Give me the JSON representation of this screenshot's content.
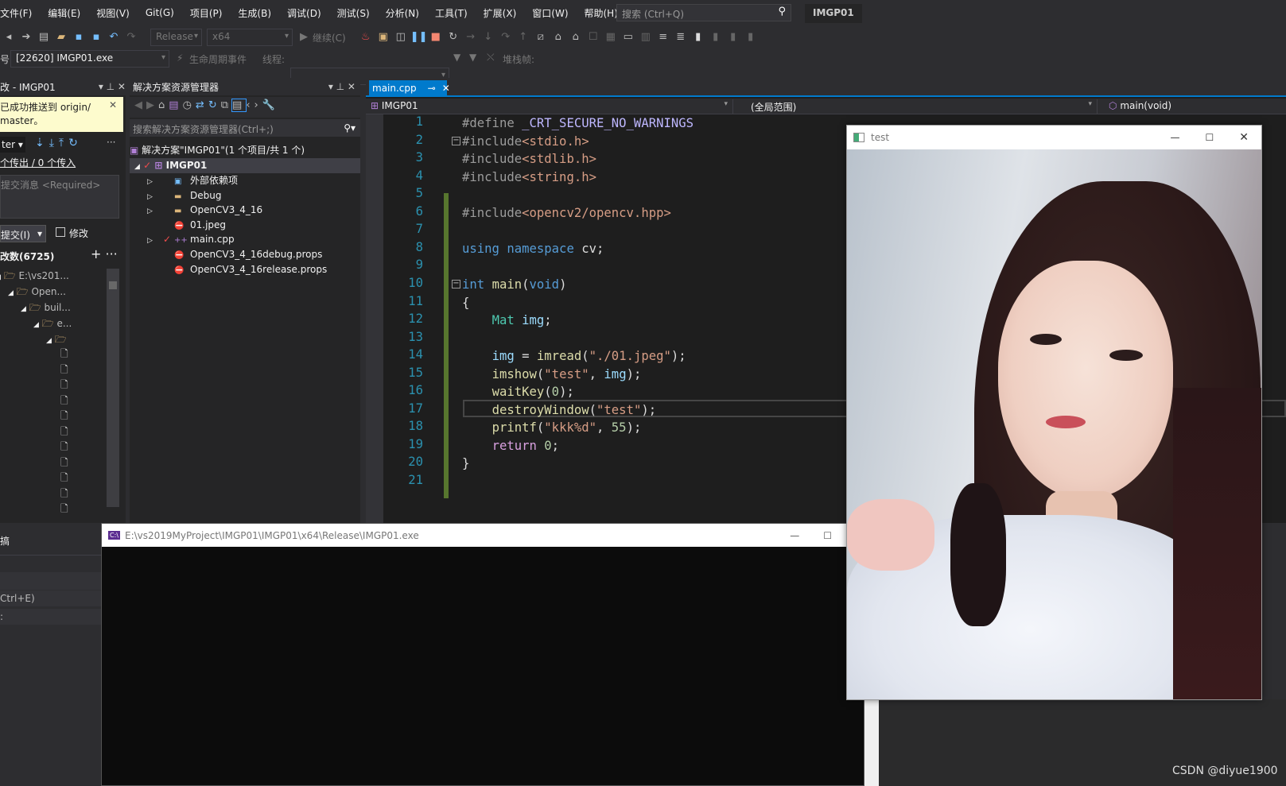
{
  "menubar": {
    "items": [
      "文件(F)",
      "编辑(E)",
      "视图(V)",
      "Git(G)",
      "项目(P)",
      "生成(B)",
      "调试(D)",
      "测试(S)",
      "分析(N)",
      "工具(T)",
      "扩展(X)",
      "窗口(W)",
      "帮助(H)"
    ],
    "search_placeholder": "搜索 (Ctrl+Q)",
    "solution_title": "IMGP01"
  },
  "toolbar": {
    "config": "Release",
    "platform": "x64",
    "continue": "继续(C)",
    "process": "[22620] IMGP01.exe",
    "lifecycle": "生命周期事件",
    "thread_label": "线程:",
    "stack_label": "堆栈帧:"
  },
  "git_panel": {
    "title": "改 - IMGP01",
    "notice_line1": "已成功推送到 origin/",
    "notice_line2": "master。",
    "branch": "ter",
    "sync": "个传出 / 0 个传入",
    "commit_placeholder": "提交消息 <Required>",
    "commit_button": "提交(I)",
    "amend_label": "修改",
    "changes": "改数(6725)",
    "tree": [
      "E:\\vs201...",
      "Open...",
      "buil...",
      "e...",
      ""
    ],
    "bottom": [
      "搞",
      "",
      "Ctrl+E)",
      ":"
    ]
  },
  "solution_explorer": {
    "title": "解决方案资源管理器",
    "search_placeholder": "搜索解决方案资源管理器(Ctrl+;)",
    "solution": "解决方案\"IMGP01\"(1 个项目/共 1 个)",
    "project": "IMGP01",
    "items": [
      {
        "label": "外部依赖项",
        "icon": "external-deps-icon",
        "expand": true
      },
      {
        "label": "Debug",
        "icon": "folder-icon",
        "expand": true
      },
      {
        "label": "OpenCV3_4_16",
        "icon": "folder-icon",
        "expand": true
      },
      {
        "label": "01.jpeg",
        "icon": "file-excluded-icon",
        "expand": false
      },
      {
        "label": "main.cpp",
        "icon": "cpp-file-icon",
        "expand": true
      },
      {
        "label": "OpenCV3_4_16debug.props",
        "icon": "file-excluded-icon",
        "expand": false
      },
      {
        "label": "OpenCV3_4_16release.props",
        "icon": "file-excluded-icon",
        "expand": false
      }
    ]
  },
  "editor": {
    "tab": "main.cpp",
    "nav_project": "IMGP01",
    "nav_scope": "(全局范围)",
    "nav_member": "main(void)",
    "lines": [
      [
        [
          "#define ",
          "pp"
        ],
        [
          "_CRT_SECURE_NO_WARNINGS",
          "mc"
        ]
      ],
      [
        [
          "#include",
          "pp"
        ],
        [
          "<stdio.h>",
          "str"
        ]
      ],
      [
        [
          "#include",
          "pp"
        ],
        [
          "<stdlib.h>",
          "str"
        ]
      ],
      [
        [
          "#include",
          "pp"
        ],
        [
          "<string.h>",
          "str"
        ]
      ],
      [],
      [
        [
          "#include",
          "pp"
        ],
        [
          "<opencv2/opencv.hpp>",
          "str"
        ]
      ],
      [],
      [
        [
          "using ",
          "kw"
        ],
        [
          "namespace ",
          "kw"
        ],
        [
          "cv;",
          "pl"
        ]
      ],
      [],
      [
        [
          "int ",
          "kw"
        ],
        [
          "main",
          "fn"
        ],
        [
          "(",
          "pl"
        ],
        [
          "void",
          "kw"
        ],
        [
          ")",
          "pl"
        ]
      ],
      [
        [
          "{",
          "pl"
        ]
      ],
      [
        [
          "    ",
          "pl"
        ],
        [
          "Mat ",
          "ty"
        ],
        [
          "img",
          "id"
        ],
        [
          ";",
          "pl"
        ]
      ],
      [],
      [
        [
          "    ",
          "pl"
        ],
        [
          "img",
          "id"
        ],
        [
          " = ",
          "pl"
        ],
        [
          "imread",
          "fn"
        ],
        [
          "(",
          "pl"
        ],
        [
          "\"./01.jpeg\"",
          "str"
        ],
        [
          ");",
          "pl"
        ]
      ],
      [
        [
          "    ",
          "pl"
        ],
        [
          "imshow",
          "fn"
        ],
        [
          "(",
          "pl"
        ],
        [
          "\"test\"",
          "str"
        ],
        [
          ", ",
          "pl"
        ],
        [
          "img",
          "id"
        ],
        [
          ");",
          "pl"
        ]
      ],
      [
        [
          "    ",
          "pl"
        ],
        [
          "waitKey",
          "fn"
        ],
        [
          "(",
          "pl"
        ],
        [
          "0",
          "num"
        ],
        [
          ");",
          "pl"
        ]
      ],
      [
        [
          "    ",
          "pl"
        ],
        [
          "destroyWindow",
          "fn"
        ],
        [
          "(",
          "pl"
        ],
        [
          "\"test\"",
          "str"
        ],
        [
          ");",
          "pl"
        ]
      ],
      [
        [
          "    ",
          "pl"
        ],
        [
          "printf",
          "fn"
        ],
        [
          "(",
          "pl"
        ],
        [
          "\"kkk%d\"",
          "str"
        ],
        [
          ", ",
          "pl"
        ],
        [
          "55",
          "num"
        ],
        [
          ");",
          "pl"
        ]
      ],
      [
        [
          "    ",
          "pl"
        ],
        [
          "return ",
          "ctl"
        ],
        [
          "0",
          "num"
        ],
        [
          ";",
          "pl"
        ]
      ],
      [
        [
          "}",
          "pl"
        ]
      ],
      []
    ]
  },
  "console": {
    "title": "E:\\vs2019MyProject\\IMGP01\\IMGP01\\x64\\Release\\IMGP01.exe"
  },
  "image_window": {
    "title": "test"
  },
  "watermark": "CSDN @diyue1900",
  "colors": {
    "accent": "#007acc",
    "background": "#1e1e1e",
    "chrome": "#2d2d30",
    "change_bar": "#57762e"
  }
}
